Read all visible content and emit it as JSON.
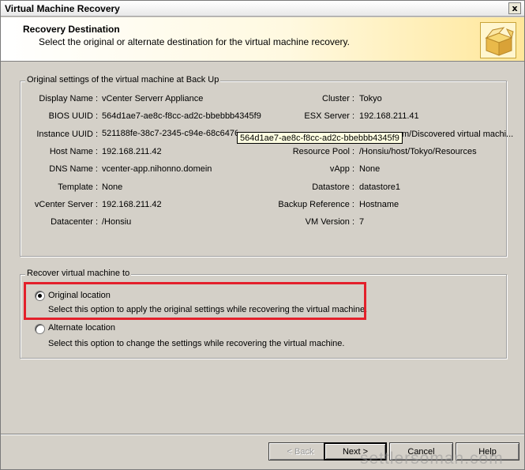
{
  "window": {
    "title": "Virtual Machine Recovery",
    "close_glyph": "x"
  },
  "header": {
    "title": "Recovery Destination",
    "subtitle": "Select the original or alternate destination for the virtual machine recovery.",
    "icon": "open-box-icon"
  },
  "original_settings": {
    "legend": "Original settings of the virtual machine at Back Up",
    "left": [
      {
        "label": "Display Name :",
        "value": "vCenter Serverr Appliance"
      },
      {
        "label": "BIOS UUID :",
        "value": "564d1ae7-ae8c-f8cc-ad2c-bbebbb4345f9"
      },
      {
        "label": "Instance UUID :",
        "value": "521188fe-38c7-2345-c94e-68c6476c"
      },
      {
        "label": "Host Name :",
        "value": "192.168.211.42"
      },
      {
        "label": "DNS Name :",
        "value": "vcenter-app.nihonno.domein"
      },
      {
        "label": "Template :",
        "value": "None"
      },
      {
        "label": "vCenter Server :",
        "value": "192.168.211.42"
      },
      {
        "label": "Datacenter :",
        "value": "/Honsiu"
      }
    ],
    "right": [
      {
        "label": "Cluster :",
        "value": "Tokyo"
      },
      {
        "label": "ESX Server :",
        "value": "192.168.211.41"
      },
      {
        "label": "",
        "value": "m/Discovered virtual machi..."
      },
      {
        "label": "Resource Pool :",
        "value": "/Honsiu/host/Tokyo/Resources"
      },
      {
        "label": "vApp :",
        "value": "None"
      },
      {
        "label": "Datastore :",
        "value": "datastore1"
      },
      {
        "label": "Backup Reference :",
        "value": "Hostname"
      },
      {
        "label": "VM Version :",
        "value": "7"
      }
    ],
    "tooltip": "564d1ae7-ae8c-f8cc-ad2c-bbebbb4345f9"
  },
  "recover_to": {
    "legend": "Recover virtual machine to",
    "options": [
      {
        "label": "Original location",
        "description": "Select this option to apply the original settings while recovering the virtual machine.",
        "selected": true
      },
      {
        "label": "Alternate location",
        "description": "Select this option to change the settings while recovering the virtual machine.",
        "selected": false
      }
    ],
    "highlight_color": "#e3202b"
  },
  "buttons": {
    "back": "< Back",
    "next": "Next >",
    "cancel": "Cancel",
    "help": "Help"
  },
  "watermark": "settlersoman.com"
}
